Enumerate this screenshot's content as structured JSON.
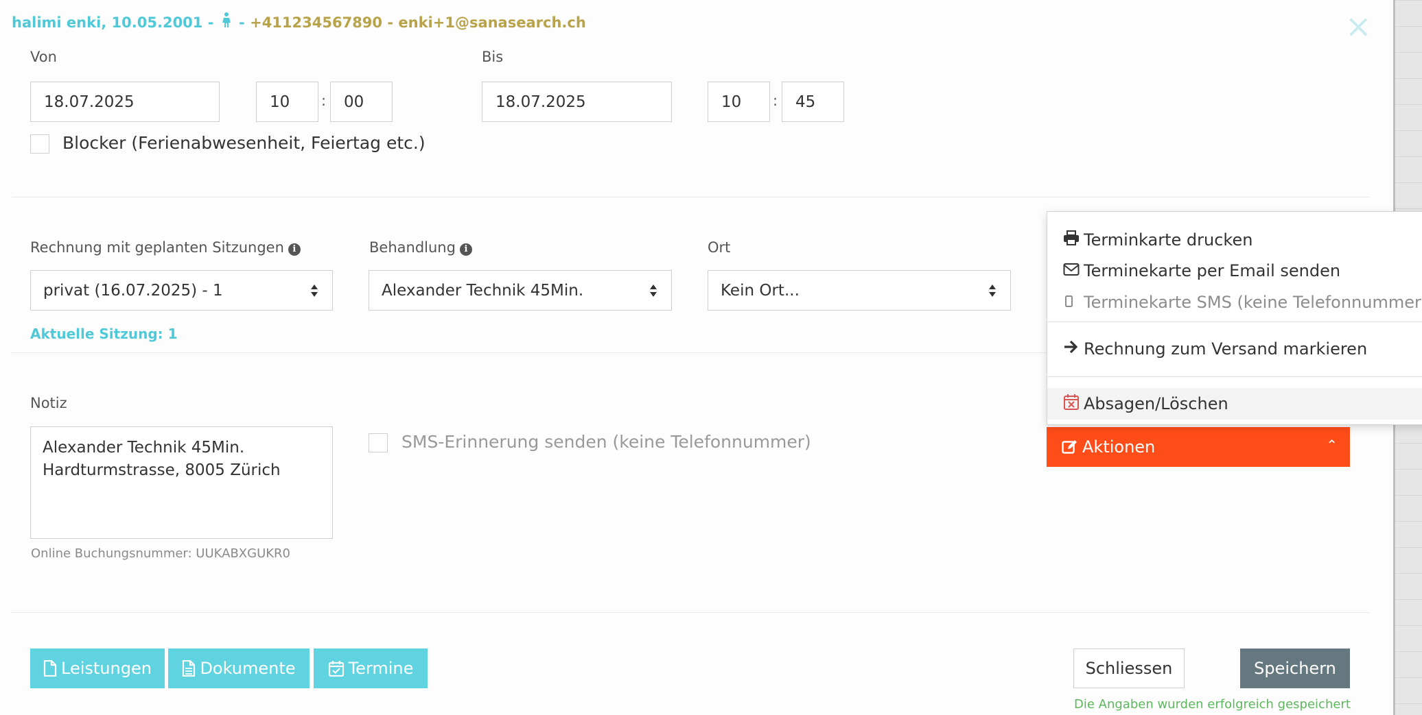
{
  "header": {
    "name_dob": "halimi enki, 10.05.2001",
    "sep1": " - ",
    "sep2": " - ",
    "phone": "+411234567890",
    "sep3": " - ",
    "email": "enki+1@sanasearch.ch"
  },
  "von": {
    "label": "Von",
    "date": "18.07.2025",
    "hour": "10",
    "minute": "00"
  },
  "bis": {
    "label": "Bis",
    "date": "18.07.2025",
    "hour": "10",
    "minute": "45"
  },
  "time_separator": ":",
  "blocker_label": "Blocker (Ferienabwesenheit, Feiertag etc.)",
  "rechnung": {
    "label": "Rechnung mit geplanten Sitzungen",
    "value": "privat (16.07.2025) - 1"
  },
  "behandlung": {
    "label": "Behandlung",
    "value": "Alexander Technik 45Min."
  },
  "ort": {
    "label": "Ort",
    "value": "Kein Ort..."
  },
  "aktuelle_sitzung": "Aktuelle Sitzung: 1",
  "notiz": {
    "label": "Notiz",
    "value": "Alexander Technik 45Min.\nHardturmstrasse, 8005 Zürich"
  },
  "booking_number": "Online Buchungsnummer: UUKABXGUKR0",
  "sms_reminder_label": "SMS-Erinnerung senden (keine Telefonnummer)",
  "aktionen": {
    "label": "Aktionen",
    "menu": [
      {
        "label": "Terminkarte drucken",
        "icon": "print-icon"
      },
      {
        "label": "Terminekarte per Email senden",
        "icon": "envelope-icon"
      },
      {
        "label": "Terminekarte SMS (keine Telefonnummer)",
        "icon": "mobile-icon"
      },
      {
        "label": "Rechnung zum Versand markieren",
        "icon": "arrow-right-icon"
      },
      {
        "label": "Absagen/Löschen",
        "icon": "calendar-x-icon"
      }
    ]
  },
  "footer": {
    "leistungen": "Leistungen",
    "dokumente": "Dokumente",
    "termine": "Termine",
    "schliessen": "Schliessen",
    "speichern": "Speichern",
    "status": "Die Angaben wurden erfolgreich gespeichert"
  },
  "close_glyph": "×",
  "colors": {
    "accent_cyan": "#5fd3df",
    "header_gold": "#b8a34a",
    "aktionen_red": "#ff4d1a",
    "save_gray": "#66787f",
    "success_green": "#5cb85c"
  }
}
